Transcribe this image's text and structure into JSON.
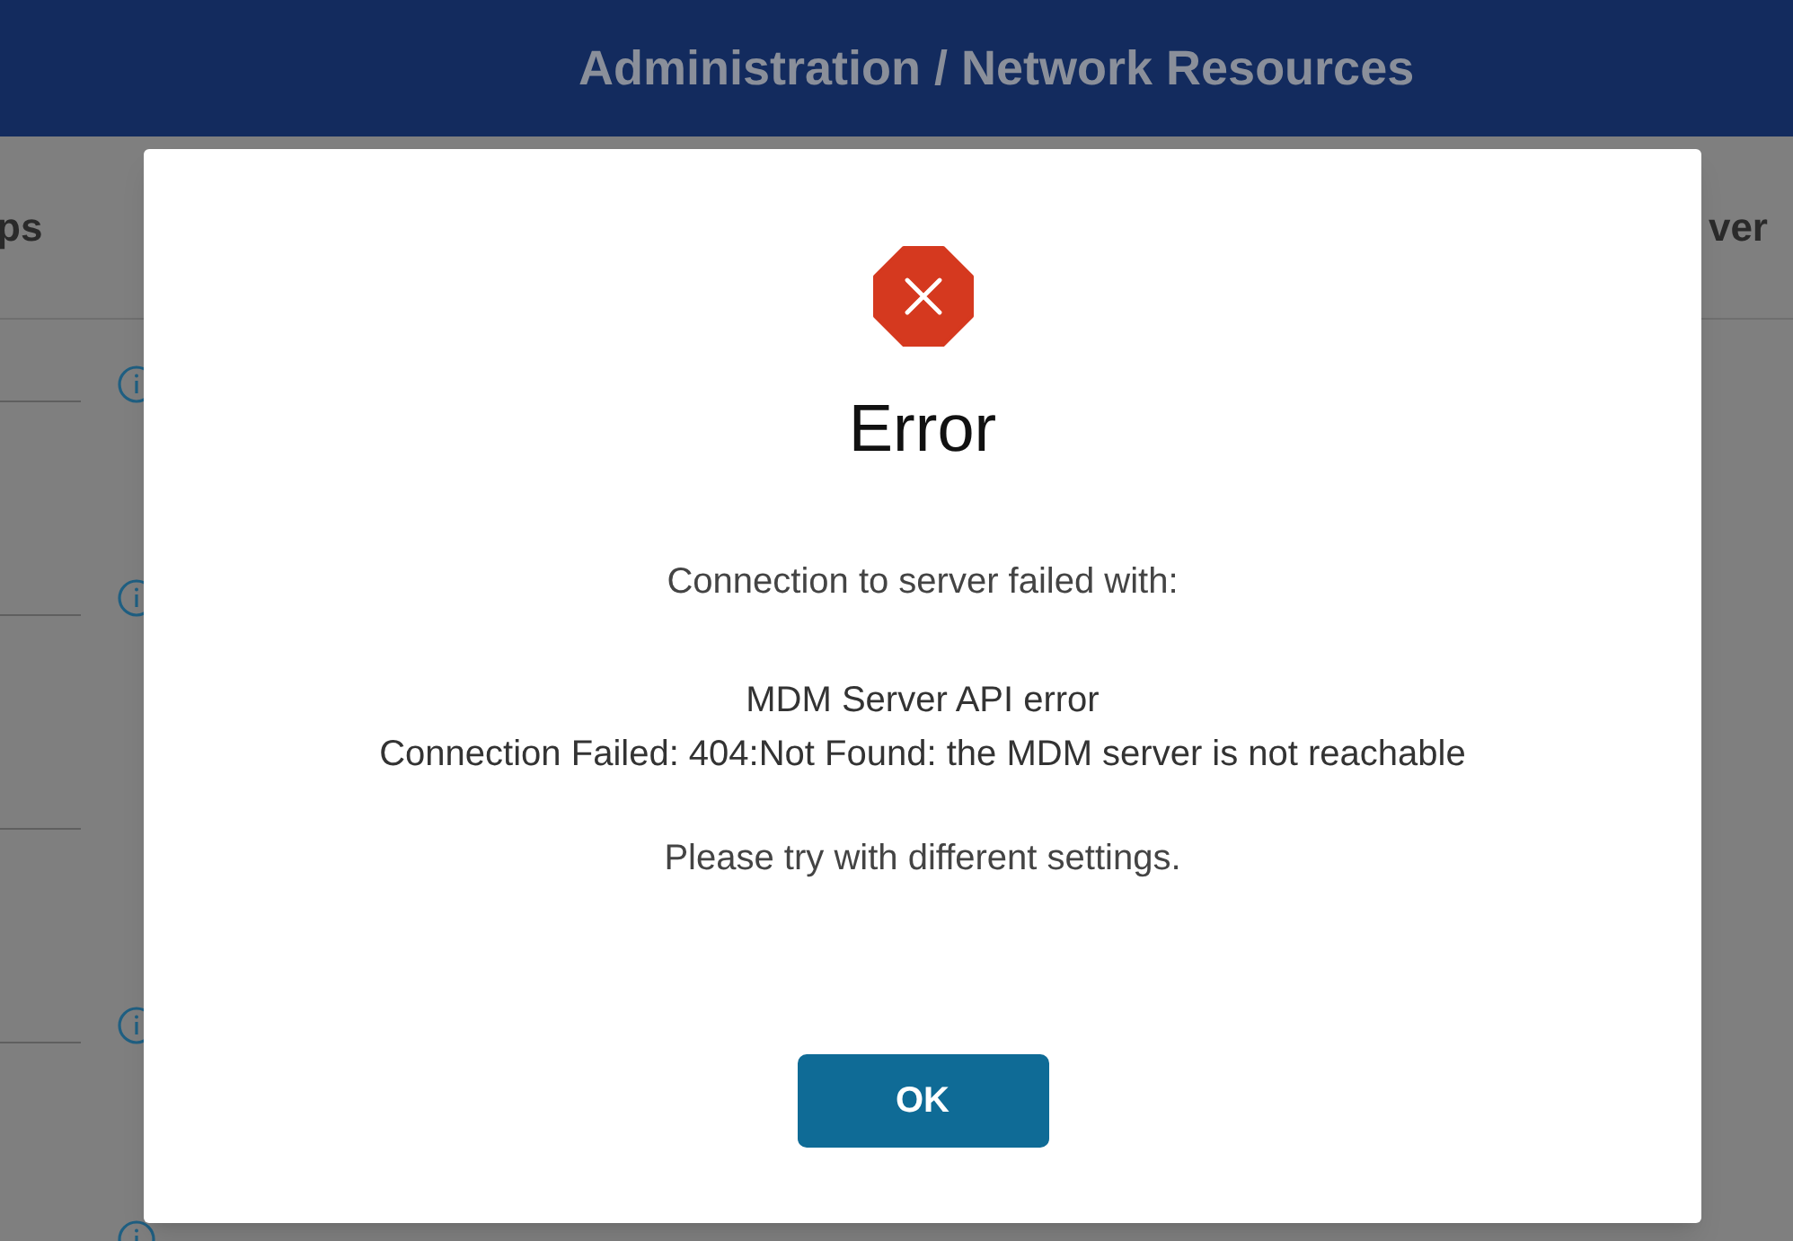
{
  "header": {
    "title": "Administration / Network Resources"
  },
  "tabs": [
    {
      "label": "ps"
    },
    {
      "label": "ver"
    }
  ],
  "fields": [
    {
      "info_icon": true
    },
    {
      "info_icon": true
    },
    {
      "info_icon": false
    },
    {
      "info_icon": true
    },
    {
      "info_icon": true
    }
  ],
  "dialog": {
    "title": "Error",
    "intro": "Connection to server failed with:",
    "details": [
      "MDM Server API error",
      "Connection Failed: 404:Not Found: the MDM server is not reachable"
    ],
    "hint": "Please try with different settings.",
    "button": "OK"
  }
}
